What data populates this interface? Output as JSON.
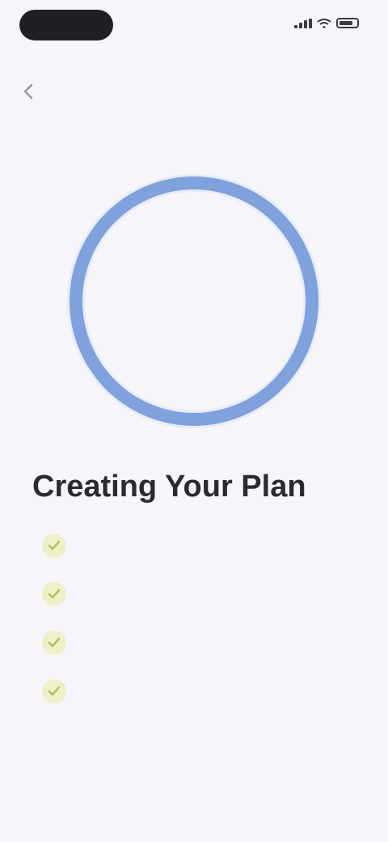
{
  "status_bar": {
    "time": "",
    "icons": [
      "signal-icon",
      "wifi-icon",
      "battery-icon"
    ]
  },
  "nav": {
    "back_icon": "chevron-left-icon",
    "title": ""
  },
  "progress": {
    "value_label": "",
    "fraction": 1.0,
    "ring_color": "#7fa2dc",
    "track_color": "#e6ecf8"
  },
  "plan": {
    "title": "Creating Your Plan"
  },
  "steps": [
    {
      "label": "",
      "icon": "check-icon",
      "done": true
    },
    {
      "label": "",
      "icon": "check-icon",
      "done": true
    },
    {
      "label": "",
      "icon": "check-icon",
      "done": true
    },
    {
      "label": "",
      "icon": "check-icon",
      "done": true
    }
  ],
  "colors": {
    "background": "#f8f5fa",
    "check_bg": "#eef0c8",
    "check_mark": "#b7bd5a"
  }
}
